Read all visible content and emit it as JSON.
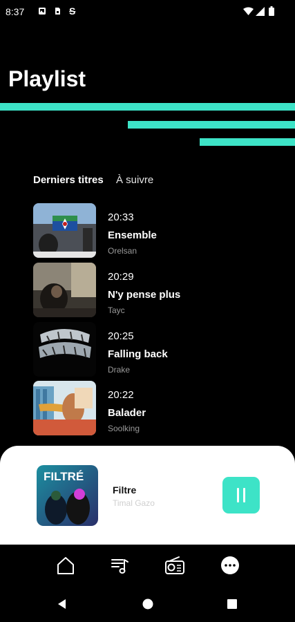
{
  "status_bar": {
    "time": "8:37",
    "left_icons": [
      "photo-notification-icon",
      "sim-card-icon",
      "strikethrough-s-icon"
    ],
    "right_icons": [
      "wifi-icon",
      "cellular-signal-icon",
      "battery-icon"
    ]
  },
  "header": {
    "title": "Playlist"
  },
  "colors": {
    "accent": "#3de3c7",
    "background": "#000000",
    "card": "#ffffff"
  },
  "tabs": [
    {
      "label": "Derniers titres",
      "active": true
    },
    {
      "label": "À suivre",
      "active": false
    }
  ],
  "tracks": [
    {
      "time": "20:33",
      "title": "Ensemble",
      "artist": "Orelsan"
    },
    {
      "time": "20:29",
      "title": "N'y pense plus",
      "artist": "Tayc"
    },
    {
      "time": "20:25",
      "title": "Falling back",
      "artist": "Drake"
    },
    {
      "time": "20:22",
      "title": "Balader",
      "artist": "Soolking"
    }
  ],
  "now_playing": {
    "title": "Filtre",
    "artist": "Timal  Gazo",
    "cover_text": "FILTRÉ",
    "state": "playing"
  },
  "bottom_nav": [
    {
      "icon": "home-icon"
    },
    {
      "icon": "playlist-music-icon"
    },
    {
      "icon": "radio-icon"
    },
    {
      "icon": "more-icon"
    }
  ],
  "system_nav": [
    "back-icon",
    "home-circle-icon",
    "recents-icon"
  ]
}
